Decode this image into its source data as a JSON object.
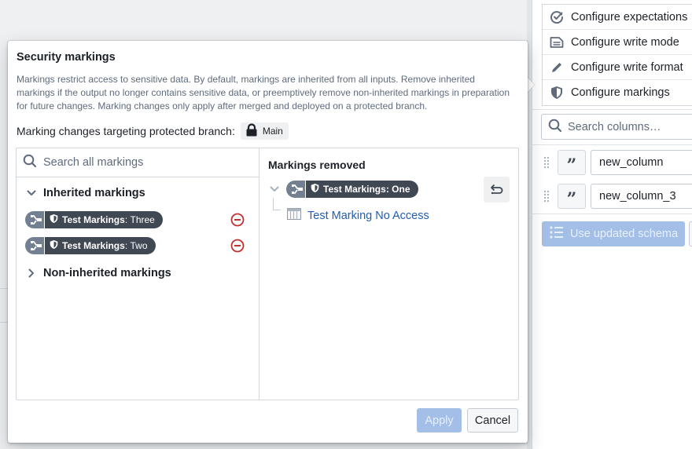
{
  "background": {
    "divider_color": "#d3d8de"
  },
  "right_panel": {
    "menu": [
      {
        "label": "Configure expectations",
        "icon": "circle-check-icon"
      },
      {
        "label": "Configure write mode",
        "icon": "document-icon"
      },
      {
        "label": "Configure write format",
        "icon": "edit-pencil-icon"
      },
      {
        "label": "Configure markings",
        "icon": "shield-icon"
      }
    ],
    "search_columns_placeholder": "Search columns…",
    "columns": [
      {
        "type_icon": "string-quote-icon",
        "name": "new_column"
      },
      {
        "type_icon": "string-quote-icon",
        "name": "new_column_3"
      }
    ],
    "use_updated_schema_label": "Use updated schema"
  },
  "dialog": {
    "title": "Security markings",
    "description": "Markings restrict access to sensitive data. By default, markings are inherited from all inputs. Remove inherited markings if the output no longer contains sensitive data, or preemptively remove non-inherited markings in preparation for future changes. Marking changes only apply after merged and deployed on a protected branch.",
    "branch_label": "Marking changes targeting protected branch:",
    "branch_name": "Main",
    "search_placeholder": "Search all markings",
    "inherited": {
      "label": "Inherited markings",
      "expanded": true,
      "items": [
        {
          "category": "Test Markings",
          "name": "Three"
        },
        {
          "category": "Test Markings",
          "name": "Two"
        }
      ]
    },
    "non_inherited": {
      "label": "Non-inherited markings",
      "expanded": false
    },
    "removed": {
      "title": "Markings removed",
      "items": [
        {
          "category": "Test Markings",
          "name": "One",
          "children": [
            {
              "label": "Test Marking No Access"
            }
          ]
        }
      ]
    },
    "apply_label": "Apply",
    "cancel_label": "Cancel"
  },
  "colors": {
    "primary_disabled": "#a3bfe8",
    "danger": "#c23030",
    "link": "#215db0",
    "tag_dark": "#404854",
    "tag_light": "#738091"
  }
}
